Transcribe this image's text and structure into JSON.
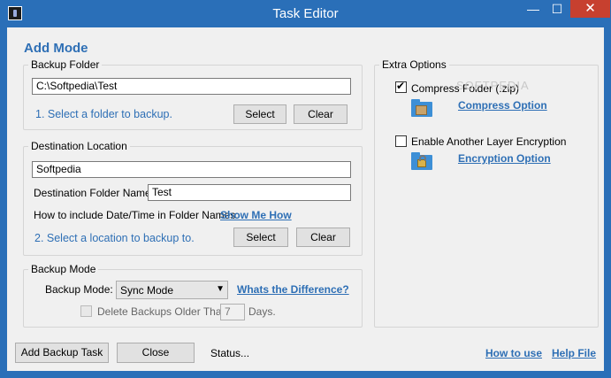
{
  "window": {
    "title": "Task Editor",
    "minimize_glyph": "—",
    "maximize_glyph": "☐",
    "close_glyph": "✕"
  },
  "heading": "Add Mode",
  "backup_folder": {
    "legend": "Backup Folder",
    "path": "C:\\Softpedia\\Test",
    "step": "1. Select a folder to backup.",
    "select_label": "Select",
    "clear_label": "Clear"
  },
  "destination": {
    "legend": "Destination Location",
    "location": "Softpedia",
    "folder_name_label": "Destination Folder Name:",
    "folder_name": "Test",
    "date_time_label": "How to include Date/Time in Folder Names:",
    "show_me_how": "Show Me How",
    "step": "2. Select a location to backup to.",
    "select_label": "Select",
    "clear_label": "Clear"
  },
  "backup_mode": {
    "legend": "Backup Mode",
    "mode_label": "Backup Mode:",
    "mode_value": "Sync Mode",
    "difference_link": "Whats the Difference?",
    "delete_label": "Delete Backups Older Than:",
    "delete_checked": false,
    "days_value": "7",
    "days_label": "Days."
  },
  "extra_options": {
    "legend": "Extra Options",
    "compress_label": "Compress Folder (.zip)",
    "compress_checked": true,
    "compress_option_link": "Compress Option",
    "encryption_label": "Enable Another Layer Encryption",
    "encryption_checked": false,
    "encryption_option_link": "Encryption Option"
  },
  "watermark": "SOFTPEDIA",
  "footer": {
    "add_task_label": "Add Backup Task",
    "close_label": "Close",
    "status": "Status...",
    "how_to_use": "How to use",
    "help_file": "Help File"
  },
  "colors": {
    "title_bar": "#2a6fb8",
    "accent": "#2e6fb5",
    "close_button": "#c7402f"
  }
}
